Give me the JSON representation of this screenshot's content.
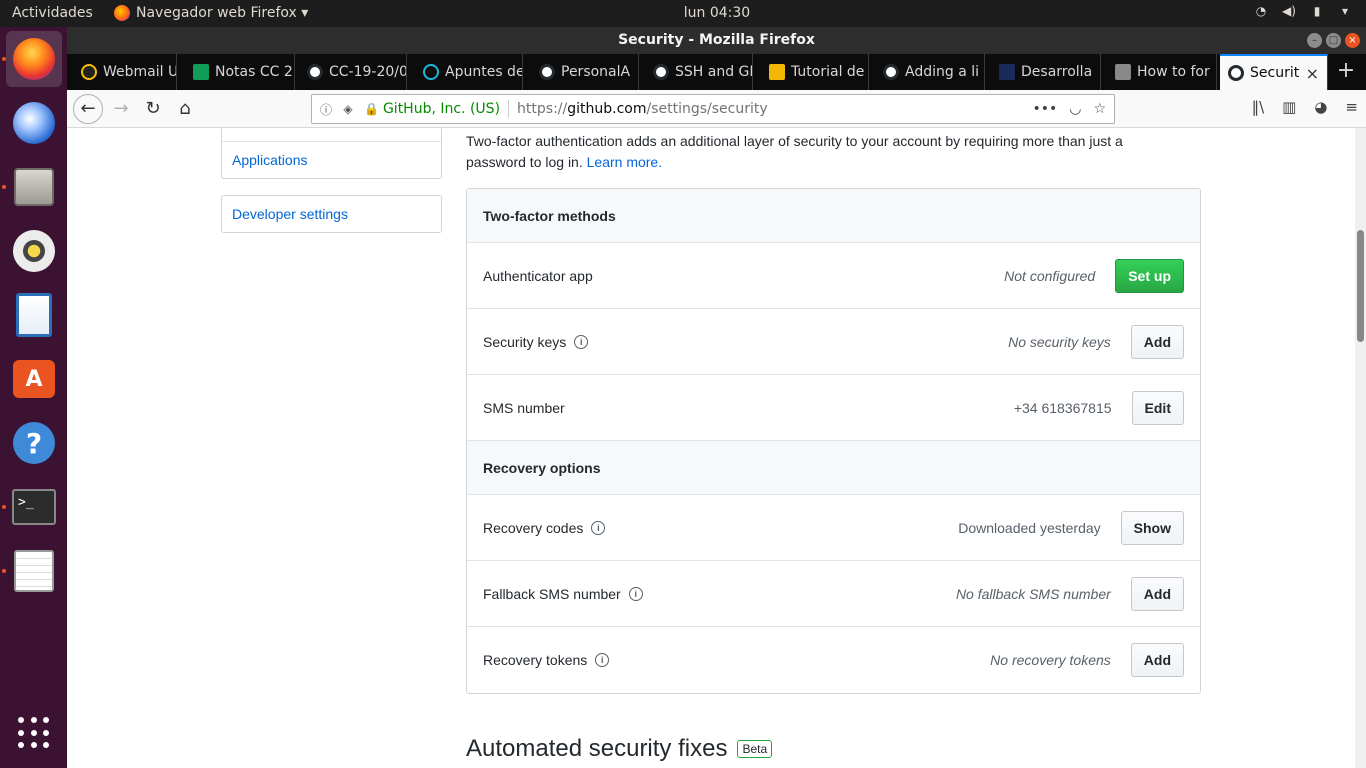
{
  "top_panel": {
    "activities": "Actividades",
    "app_menu": "Navegador web Firefox ▾",
    "clock": "lun 04:30"
  },
  "window": {
    "title": "Security - Mozilla Firefox"
  },
  "tabs": [
    {
      "label": "Webmail U",
      "icon": "tux"
    },
    {
      "label": "Notas CC 2",
      "icon": "sheet"
    },
    {
      "label": "CC-19-20/0",
      "icon": "gh"
    },
    {
      "label": "Apuntes de",
      "icon": "cc"
    },
    {
      "label": "PersonalA",
      "icon": "gh"
    },
    {
      "label": "SSH and GF",
      "icon": "gh"
    },
    {
      "label": "Tutorial de",
      "icon": "dd"
    },
    {
      "label": "Adding a li",
      "icon": "gh"
    },
    {
      "label": "Desarrolla",
      "icon": "sq"
    },
    {
      "label": "How to for",
      "icon": "av"
    },
    {
      "label": "Security",
      "icon": "gh",
      "active": true
    }
  ],
  "urlbar": {
    "org": "GitHub, Inc. (US)",
    "url_scheme": "https://",
    "url_host": "github.com",
    "url_path": "/settings/security"
  },
  "sidebar": {
    "applications": "Applications",
    "developer_settings": "Developer settings"
  },
  "intro": {
    "text": "Two-factor authentication adds an additional layer of security to your account by requiring more than just a password to log in.",
    "learn_more": "Learn more."
  },
  "methods": {
    "header": "Two-factor methods",
    "authenticator": {
      "label": "Authenticator app",
      "status": "Not configured",
      "button": "Set up"
    },
    "security_keys": {
      "label": "Security keys",
      "status": "No security keys",
      "button": "Add"
    },
    "sms": {
      "label": "SMS number",
      "status": "+34 618367815",
      "button": "Edit"
    },
    "recovery_header": "Recovery options",
    "recovery_codes": {
      "label": "Recovery codes",
      "status": "Downloaded yesterday",
      "button": "Show"
    },
    "fallback_sms": {
      "label": "Fallback SMS number",
      "status": "No fallback SMS number",
      "button": "Add"
    },
    "recovery_tokens": {
      "label": "Recovery tokens",
      "status": "No recovery tokens",
      "button": "Add"
    }
  },
  "automated": {
    "title": "Automated security fixes",
    "badge": "Beta"
  },
  "colors": {
    "accent_green": "#28a745",
    "link_blue": "#0366d6",
    "ubuntu_orange": "#e95420"
  }
}
